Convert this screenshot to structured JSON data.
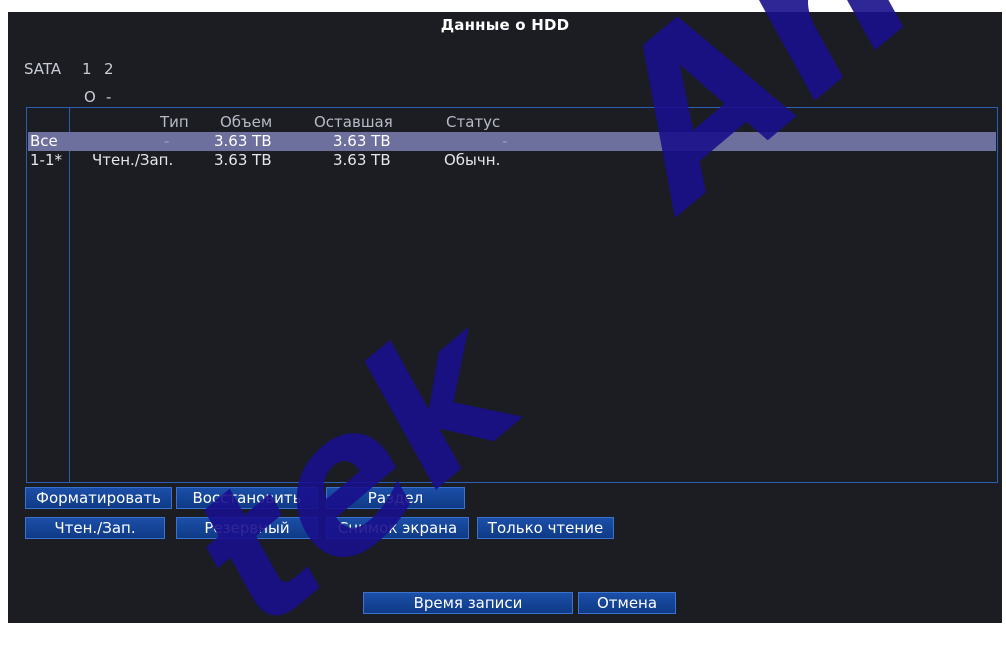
{
  "window": {
    "title": "Данные о HDD"
  },
  "sata": {
    "label": "SATA",
    "ports": [
      "1",
      "2"
    ],
    "states": [
      "O",
      "-"
    ]
  },
  "table": {
    "columns": [
      "Тип",
      "Объем",
      "Оставшая",
      "Статус"
    ],
    "rows": [
      {
        "id": "Все",
        "type": "-",
        "capacity": "3.63 TB",
        "remaining": "3.63 TB",
        "status": "-"
      },
      {
        "id": "1-1*",
        "type": "Чтен./Зап.",
        "capacity": "3.63 TB",
        "remaining": "3.63 TB",
        "status": "Обычн."
      }
    ]
  },
  "buttons": {
    "format": "Форматировать",
    "restore": "Восстановить",
    "partition": "Раздел",
    "readwrite": "Чтен./Зап.",
    "backup": "Резервный",
    "snapshot": "Снимок экрана",
    "readonly": "Только чтение",
    "record_time": "Время записи",
    "cancel": "Отмена"
  },
  "watermark": {
    "text_top": "An",
    "text_bottom": "tek"
  },
  "colors": {
    "background": "#1b1d22",
    "accent": "#2b5fb4",
    "button": "#1b4fa8",
    "selected_row": "#6d6f9c",
    "watermark": "#1a108c"
  }
}
